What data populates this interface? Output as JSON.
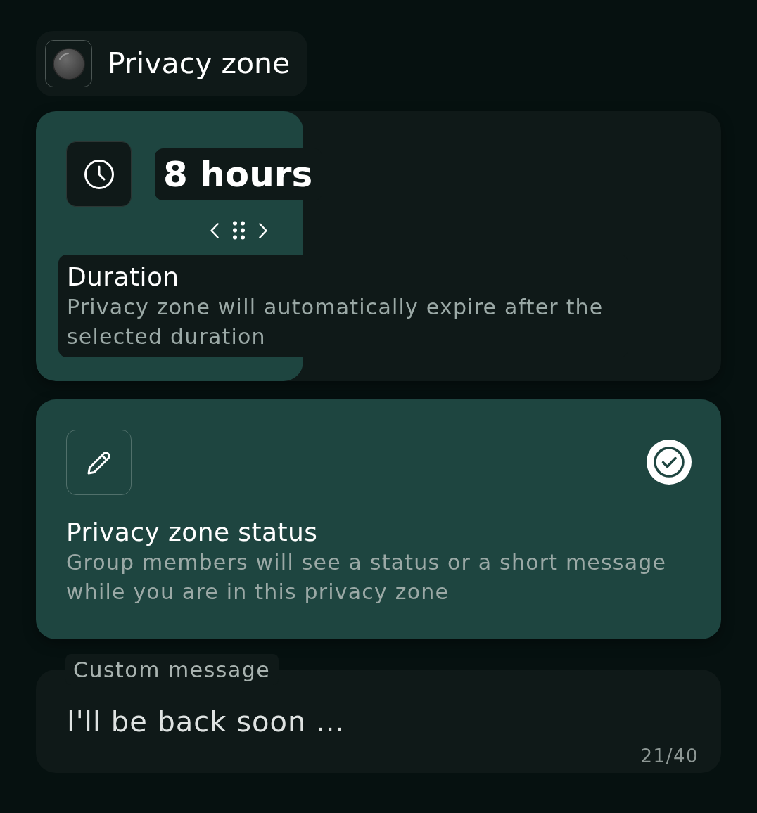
{
  "header": {
    "title": "Privacy zone"
  },
  "duration_card": {
    "value": "8 hours",
    "title": "Duration",
    "description": "Privacy zone will automatically expire after the selected duration"
  },
  "status_card": {
    "title": "Privacy zone status",
    "description": "Group members will see a status or a short message while you are in this privacy zone",
    "checked": true
  },
  "custom_message": {
    "label": "Custom message",
    "value": "I'll be back soon ...",
    "counter": "21/40"
  }
}
